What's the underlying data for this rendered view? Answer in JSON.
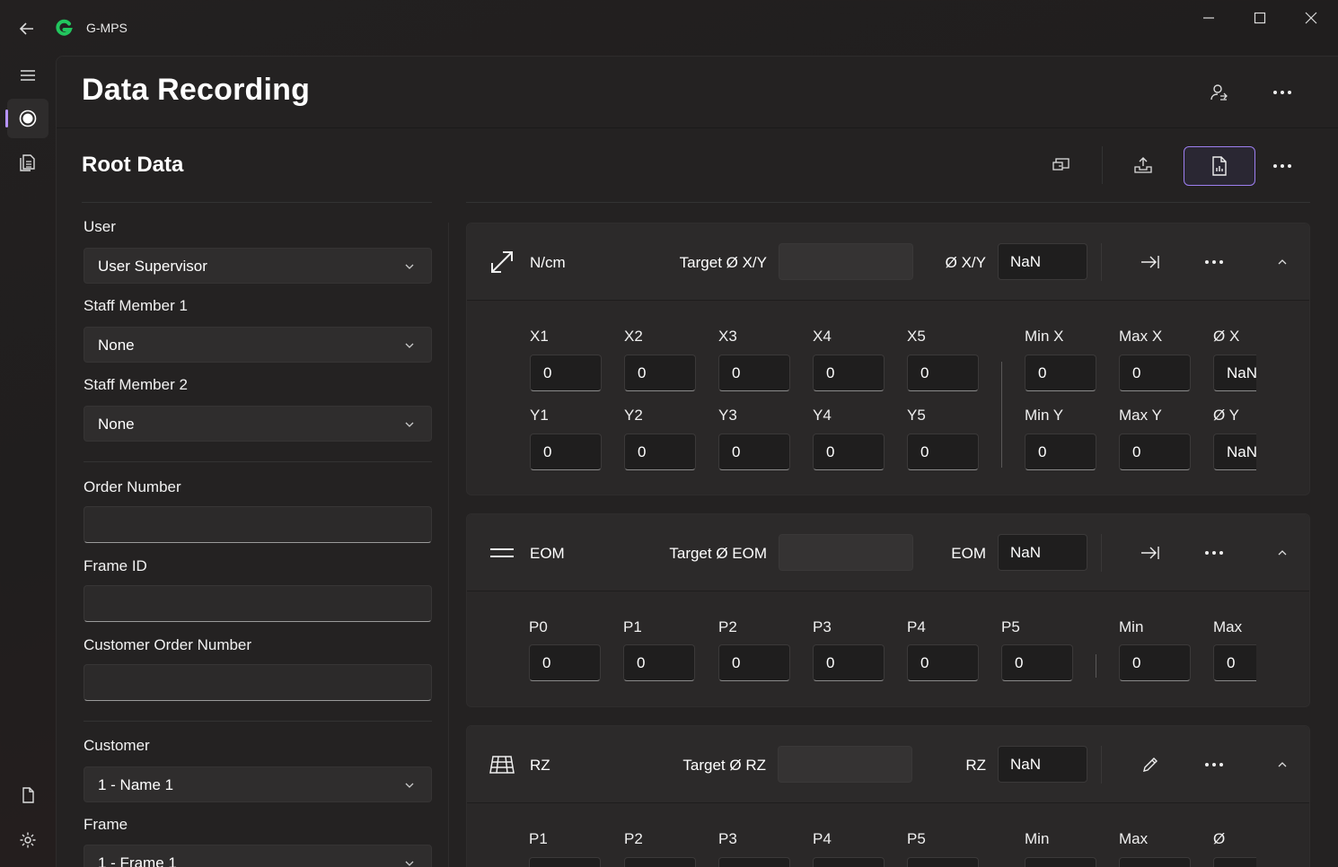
{
  "app": {
    "title": "G-MPS",
    "logo_color": "#22c55e",
    "accent": "#b794ff"
  },
  "page": {
    "title": "Data Recording"
  },
  "section": {
    "title": "Root Data"
  },
  "form": {
    "user_label": "User",
    "user_value": "User Supervisor",
    "staff1_label": "Staff Member 1",
    "staff1_value": "None",
    "staff2_label": "Staff Member 2",
    "staff2_value": "None",
    "order_label": "Order Number",
    "order_value": "",
    "frame_id_label": "Frame ID",
    "frame_id_value": "",
    "cust_order_label": "Customer Order Number",
    "cust_order_value": "",
    "customer_label": "Customer",
    "customer_value": "1 - Name 1",
    "frame_label": "Frame",
    "frame_value": "1 - Frame 1"
  },
  "cards": {
    "ncm": {
      "title": "N/cm",
      "target_label": "Target Ø X/Y",
      "target_value": "",
      "result_label": "Ø X/Y",
      "result_value": "NaN",
      "x_headers": [
        "X1",
        "X2",
        "X3",
        "X4",
        "X5"
      ],
      "x_values": [
        "0",
        "0",
        "0",
        "0",
        "0"
      ],
      "x_stat_headers": [
        "Min X",
        "Max X",
        "Ø X"
      ],
      "x_stats": [
        "0",
        "0",
        "NaN"
      ],
      "y_headers": [
        "Y1",
        "Y2",
        "Y3",
        "Y4",
        "Y5"
      ],
      "y_values": [
        "0",
        "0",
        "0",
        "0",
        "0"
      ],
      "y_stat_headers": [
        "Min Y",
        "Max Y",
        "Ø Y"
      ],
      "y_stats": [
        "0",
        "0",
        "NaN"
      ]
    },
    "eom": {
      "title": "EOM",
      "target_label": "Target Ø EOM",
      "target_value": "",
      "result_label": "EOM",
      "result_value": "NaN",
      "headers": [
        "P0",
        "P1",
        "P2",
        "P3",
        "P4",
        "P5"
      ],
      "values": [
        "0",
        "0",
        "0",
        "0",
        "0",
        "0"
      ],
      "stat_headers": [
        "Min",
        "Max"
      ],
      "stats": [
        "0",
        "0"
      ]
    },
    "rz": {
      "title": "RZ",
      "target_label": "Target Ø RZ",
      "target_value": "",
      "result_label": "RZ",
      "result_value": "NaN",
      "headers": [
        "P1",
        "P2",
        "P3",
        "P4",
        "P5"
      ],
      "stat_headers": [
        "Min",
        "Max",
        "Ø"
      ]
    }
  }
}
